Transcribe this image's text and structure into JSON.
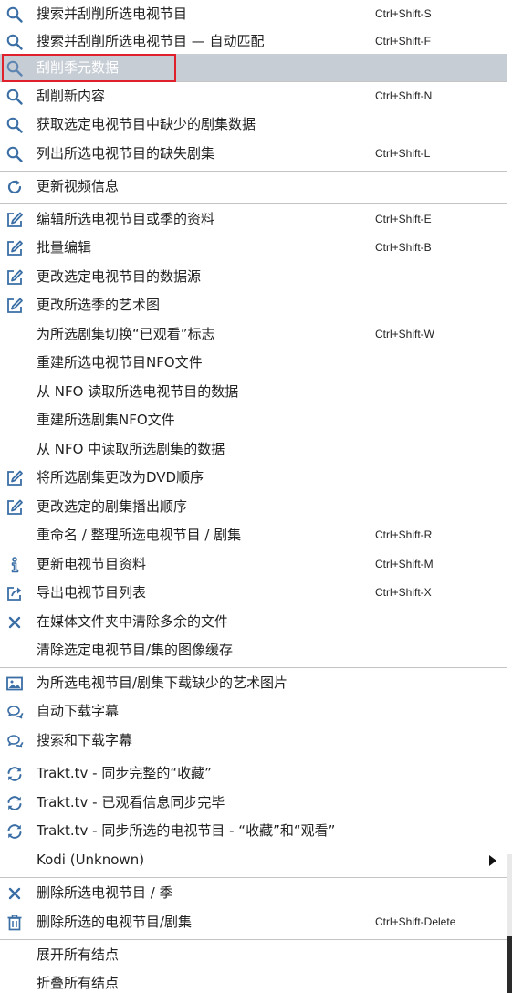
{
  "menu": {
    "items": [
      {
        "label": "搜索并刮削所选电视节目",
        "shortcut": "Ctrl+Shift-S",
        "icon": "search-icon"
      },
      {
        "label": "搜索并刮削所选电视节目 — 自动匹配",
        "shortcut": "Ctrl+Shift-F",
        "icon": "search-icon"
      },
      {
        "label": "刮削季元数据",
        "shortcut": "",
        "icon": "search-icon",
        "selected": true
      },
      {
        "label": "刮削新内容",
        "shortcut": "Ctrl+Shift-N",
        "icon": "search-icon"
      },
      {
        "label": "获取选定电视节目中缺少的剧集数据",
        "shortcut": "",
        "icon": "search-icon"
      },
      {
        "label": "列出所选电视节目的缺失剧集",
        "shortcut": "Ctrl+Shift-L",
        "icon": "search-icon"
      },
      {
        "label": "更新视频信息",
        "shortcut": "",
        "icon": "refresh-icon"
      },
      {
        "label": "编辑所选电视节目或季的资料",
        "shortcut": "Ctrl+Shift-E",
        "icon": "edit-icon"
      },
      {
        "label": "批量编辑",
        "shortcut": "Ctrl+Shift-B",
        "icon": "edit-icon"
      },
      {
        "label": "更改选定电视节目的数据源",
        "shortcut": "",
        "icon": "edit-icon"
      },
      {
        "label": "更改所选季的艺术图",
        "shortcut": "",
        "icon": "edit-icon"
      },
      {
        "label": "为所选剧集切换“已观看”标志",
        "shortcut": "Ctrl+Shift-W",
        "icon": ""
      },
      {
        "label": "重建所选电视节目NFO文件",
        "shortcut": "",
        "icon": ""
      },
      {
        "label": "从 NFO 读取所选电视节目的数据",
        "shortcut": "",
        "icon": ""
      },
      {
        "label": "重建所选剧集NFO文件",
        "shortcut": "",
        "icon": ""
      },
      {
        "label": "从 NFO 中读取所选剧集的数据",
        "shortcut": "",
        "icon": ""
      },
      {
        "label": "将所选剧集更改为DVD顺序",
        "shortcut": "",
        "icon": "edit-icon"
      },
      {
        "label": "更改选定的剧集播出顺序",
        "shortcut": "",
        "icon": "edit-icon"
      },
      {
        "label": "重命名 / 整理所选电视节目 / 剧集",
        "shortcut": "Ctrl+Shift-R",
        "icon": ""
      },
      {
        "label": "更新电视节目资料",
        "shortcut": "Ctrl+Shift-M",
        "icon": "info-icon"
      },
      {
        "label": "导出电视节目列表",
        "shortcut": "Ctrl+Shift-X",
        "icon": "export-icon"
      },
      {
        "label": "在媒体文件夹中清除多余的文件",
        "shortcut": "",
        "icon": "close-icon"
      },
      {
        "label": "清除选定电视节目/集的图像缓存",
        "shortcut": "",
        "icon": ""
      },
      {
        "label": "为所选电视节目/剧集下载缺少的艺术图片",
        "shortcut": "",
        "icon": "image-icon"
      },
      {
        "label": "自动下载字幕",
        "shortcut": "",
        "icon": "chat-icon"
      },
      {
        "label": "搜索和下载字幕",
        "shortcut": "",
        "icon": "chat-icon"
      },
      {
        "label": "Trakt.tv - 同步完整的“收藏”",
        "shortcut": "",
        "icon": "sync-icon"
      },
      {
        "label": "Trakt.tv - 已观看信息同步完毕",
        "shortcut": "",
        "icon": "sync-icon"
      },
      {
        "label": "Trakt.tv - 同步所选的电视节目 - “收藏”和“观看”",
        "shortcut": "",
        "icon": "sync-icon"
      },
      {
        "label": "Kodi (Unknown)",
        "shortcut": "",
        "icon": "",
        "submenu": true
      },
      {
        "label": "删除所选电视节目 / 季",
        "shortcut": "",
        "icon": "close-icon"
      },
      {
        "label": "删除所选的电视节目/剧集",
        "shortcut": "Ctrl+Shift-Delete",
        "icon": "trash-icon"
      },
      {
        "label": "展开所有结点",
        "shortcut": "",
        "icon": ""
      },
      {
        "label": "折叠所有结点",
        "shortcut": "",
        "icon": ""
      }
    ]
  },
  "colors": {
    "icon_blue": "#3a6ea5",
    "selection_bg": "#c7cdd5",
    "highlight_border": "#e0202a",
    "separator": "#c4c4c4"
  }
}
